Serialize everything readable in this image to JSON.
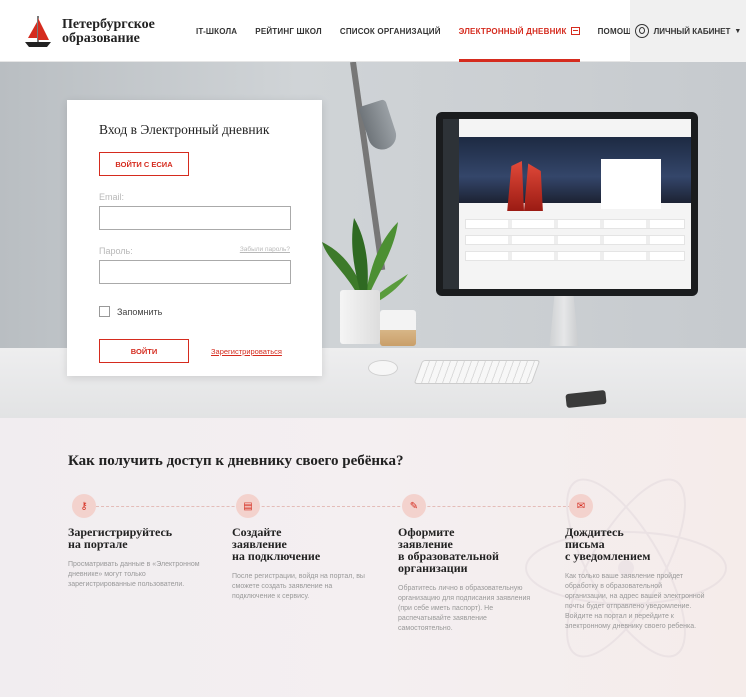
{
  "header": {
    "logo_line1": "Петербургское",
    "logo_line2": "образование",
    "nav": [
      {
        "label": "IT-ШКОЛА"
      },
      {
        "label": "РЕЙТИНГ ШКОЛ"
      },
      {
        "label": "СПИСОК ОРГАНИЗАЦИЙ"
      },
      {
        "label": "ЭЛЕКТРОННЫЙ ДНЕВНИК"
      },
      {
        "label": "ПОМОЩЬ"
      }
    ],
    "cabinet_label": "ЛИЧНЫЙ КАБИНЕТ",
    "accent": "#d52b1e"
  },
  "login": {
    "title": "Вход в Электронный дневник",
    "esia_button": "ВОЙТИ С ЕСИА",
    "email_label": "Email:",
    "email_value": "",
    "password_label": "Пароль:",
    "forgot": "Забыли пароль?",
    "password_value": "",
    "remember": "Запомнить",
    "login_button": "ВОЙТИ",
    "register_link": "Зарегистрироваться"
  },
  "info": {
    "title": "Как получить доступ к дневнику своего ребёнка?",
    "steps": [
      {
        "icon": "key-icon",
        "title_1": "Зарегистрируйтесь",
        "title_2": "на портале",
        "title_3": "",
        "title_4": "",
        "text": "Просматривать данные в «Электронном дневнике» могут только зарегистрированные пользователи."
      },
      {
        "icon": "document-icon",
        "title_1": "Создайте",
        "title_2": "заявление",
        "title_3": "на подключение",
        "title_4": "",
        "text": "После регистрации, войдя на портал, вы сможете создать заявление на подключение к сервису."
      },
      {
        "icon": "edit-icon",
        "title_1": "Оформите",
        "title_2": "заявление",
        "title_3": "в образовательной",
        "title_4": "организации",
        "text": "Обратитесь лично в образовательную организацию для подписания заявления (при себе иметь паспорт). Не распечатывайте заявление самостоятельно."
      },
      {
        "icon": "mail-icon",
        "title_1": "Дождитесь",
        "title_2": "письма",
        "title_3": "с уведомлением",
        "title_4": "",
        "text": "Как только ваше заявление пройдет обработку в образовательной организации, на адрес вашей электронной почты будет отправлено уведомление. Войдите на портал и перейдите к электронному дневнику своего ребенка."
      }
    ]
  }
}
